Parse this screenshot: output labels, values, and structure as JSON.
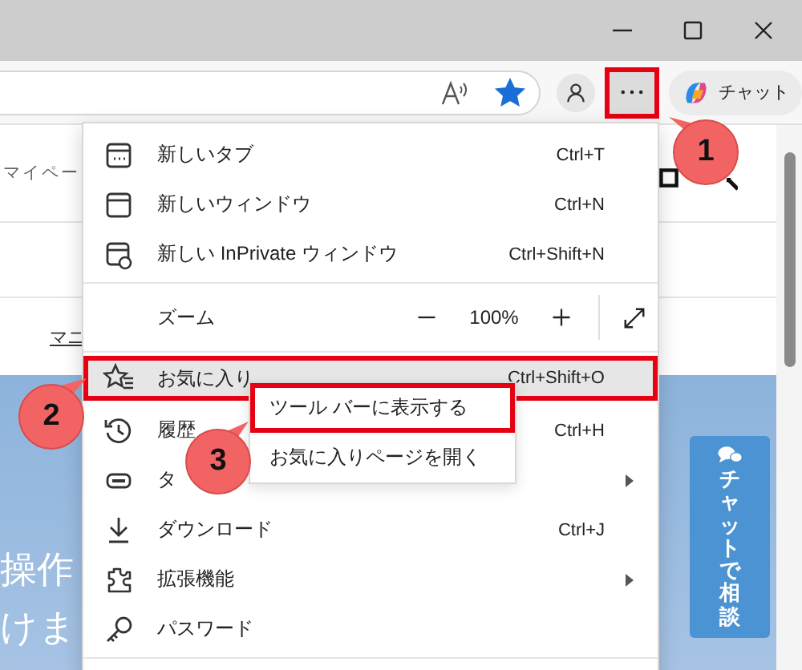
{
  "toolbar": {
    "favorite_starred": true,
    "more_button": {
      "selected": true,
      "annotated": true
    },
    "chat_button": "チャット"
  },
  "page": {
    "nav_text": "マイペー",
    "link_text": "マニ",
    "hero_lines": [
      "操作",
      "けま"
    ],
    "consult_button": "チャットで相談"
  },
  "menu": {
    "items": [
      {
        "kind": "item",
        "label": "新しいタブ",
        "shortcut": "Ctrl+T",
        "submenu": false,
        "selected": false,
        "annotated": false
      },
      {
        "kind": "item",
        "label": "新しいウィンドウ",
        "shortcut": "Ctrl+N",
        "submenu": false,
        "selected": false,
        "annotated": false
      },
      {
        "kind": "item",
        "label": "新しい InPrivate ウィンドウ",
        "shortcut": "Ctrl+Shift+N",
        "submenu": false,
        "selected": false,
        "annotated": false
      },
      {
        "kind": "divider"
      },
      {
        "kind": "zoom",
        "label": "ズーム",
        "value": "100%"
      },
      {
        "kind": "divider"
      },
      {
        "kind": "item",
        "label": "お気に入り",
        "shortcut": "Ctrl+Shift+O",
        "submenu": false,
        "selected": true,
        "annotated": true
      },
      {
        "kind": "item",
        "label": "履歴",
        "shortcut": "Ctrl+H",
        "submenu": false,
        "selected": false,
        "annotated": false
      },
      {
        "kind": "item",
        "label": "タ",
        "submenu": true,
        "selected": false,
        "annotated": false
      },
      {
        "kind": "item",
        "label": "ダウンロード",
        "shortcut": "Ctrl+J",
        "submenu": false,
        "selected": false,
        "annotated": false
      },
      {
        "kind": "item",
        "label": "拡張機能",
        "submenu": true,
        "selected": false,
        "annotated": false
      },
      {
        "kind": "item",
        "label": "パスワード",
        "submenu": false,
        "selected": false,
        "annotated": false
      },
      {
        "kind": "divider"
      }
    ]
  },
  "submenu": {
    "items": [
      {
        "label": "ツール バーに表示する",
        "annotated": true
      },
      {
        "label": "お気に入りページを開く",
        "annotated": false
      }
    ]
  },
  "callouts": [
    {
      "number": "1"
    },
    {
      "number": "2"
    },
    {
      "number": "3"
    }
  ]
}
